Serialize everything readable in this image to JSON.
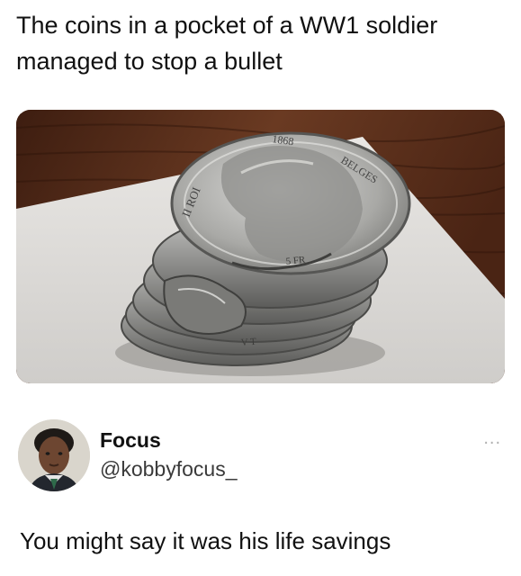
{
  "post": {
    "caption": "The coins in a pocket of a WW1 soldier managed to stop a bullet",
    "photo_icon": "coin-stack-photo"
  },
  "tweet": {
    "display_name": "Focus",
    "handle": "@kobbyfocus_",
    "more_label": "...",
    "text": "You might say it was his life savings"
  },
  "coin": {
    "inscription_top": "1868",
    "inscription_right": "BELGES",
    "inscription_left": "II ROI",
    "edge_text_1": "5 FR",
    "edge_text_2": "V T"
  }
}
